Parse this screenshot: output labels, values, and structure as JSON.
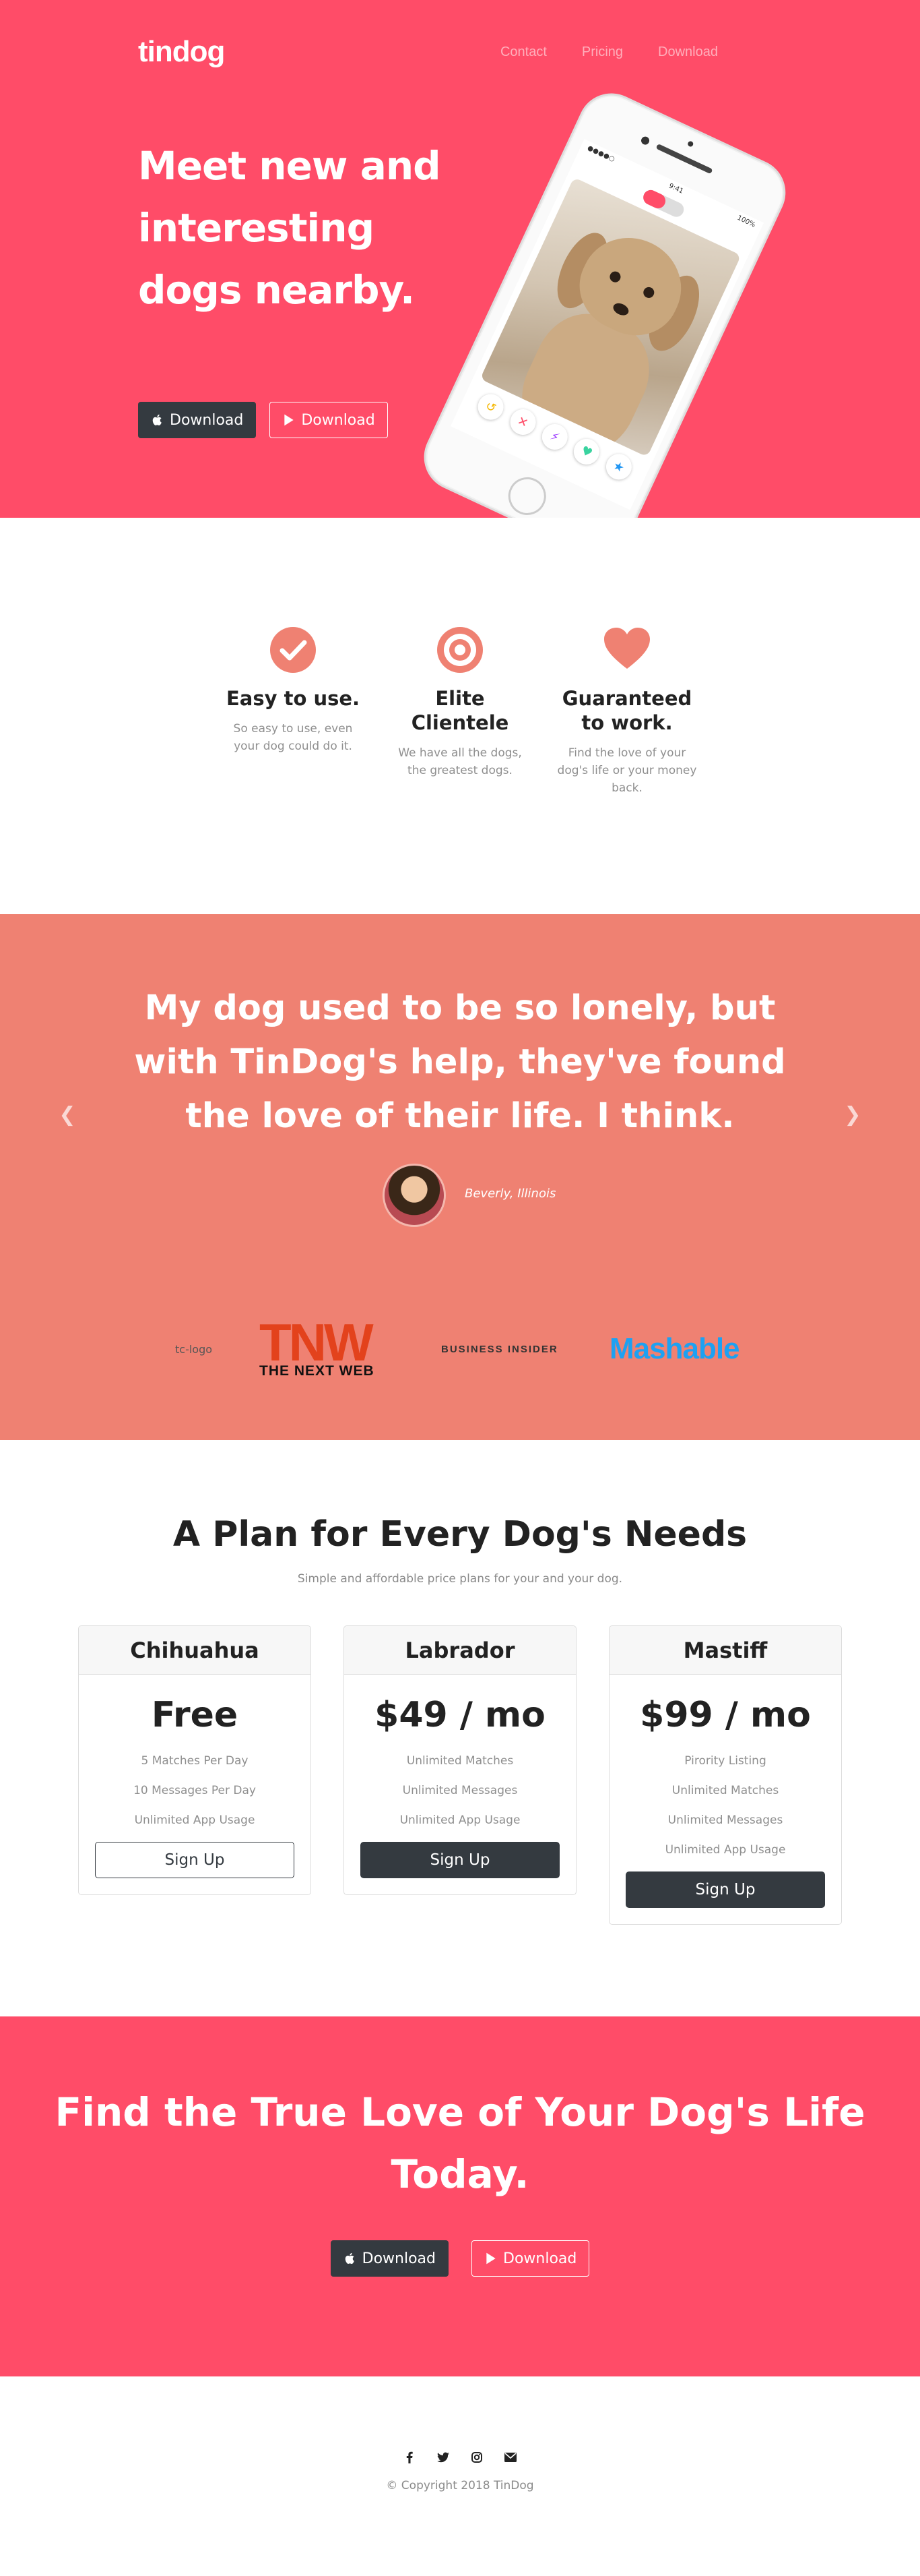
{
  "hero": {
    "brand": "tindog",
    "nav": [
      "Contact",
      "Pricing",
      "Download"
    ],
    "title": "Meet new and interesting dogs nearby.",
    "buttons": {
      "apple": "Download",
      "google": "Download"
    }
  },
  "features": [
    {
      "icon": "check-circle-icon",
      "title": "Easy to use.",
      "text": "So easy to use, even your dog could do it."
    },
    {
      "icon": "bullseye-icon",
      "title": "Elite Clientele",
      "text": "We have all the dogs, the greatest dogs."
    },
    {
      "icon": "heart-icon",
      "title": "Guaranteed to work.",
      "text": "Find the love of your dog's life or your money back."
    }
  ],
  "testimonial": {
    "quote": "My dog used to be so lonely, but with TinDog's help, they've found the love of their life. I think.",
    "author": "Beverly, Illinois"
  },
  "press": {
    "techcrunch_alt": "tc-logo",
    "tnw_big": "TNW",
    "tnw_small": "THE NEXT WEB",
    "business_insider": "BUSINESS INSIDER",
    "mashable": "Mashable"
  },
  "pricing": {
    "title": "A Plan for Every Dog's Needs",
    "subtitle": "Simple and affordable price plans for your and your dog.",
    "plans": [
      {
        "name": "Chihuahua",
        "price": "Free",
        "features": [
          "5 Matches Per Day",
          "10 Messages Per Day",
          "Unlimited App Usage"
        ],
        "button": "Sign Up"
      },
      {
        "name": "Labrador",
        "price": "$49 / mo",
        "features": [
          "Unlimited Matches",
          "Unlimited Messages",
          "Unlimited App Usage"
        ],
        "button": "Sign Up"
      },
      {
        "name": "Mastiff",
        "price": "$99 / mo",
        "features": [
          "Pirority Listing",
          "Unlimited Matches",
          "Unlimited Messages",
          "Unlimited App Usage"
        ],
        "button": "Sign Up"
      }
    ]
  },
  "cta": {
    "title": "Find the True Love of Your Dog's Life Today.",
    "buttons": {
      "apple": "Download",
      "google": "Download"
    }
  },
  "footer": {
    "social": [
      "facebook-icon",
      "twitter-icon",
      "instagram-icon",
      "envelope-icon"
    ],
    "copyright": "© Copyright 2018 TinDog"
  },
  "colors": {
    "primary": "#ff4c68",
    "testimonial_bg": "#ef8172",
    "feature_icon": "#ef8172",
    "dark": "#343a40"
  }
}
